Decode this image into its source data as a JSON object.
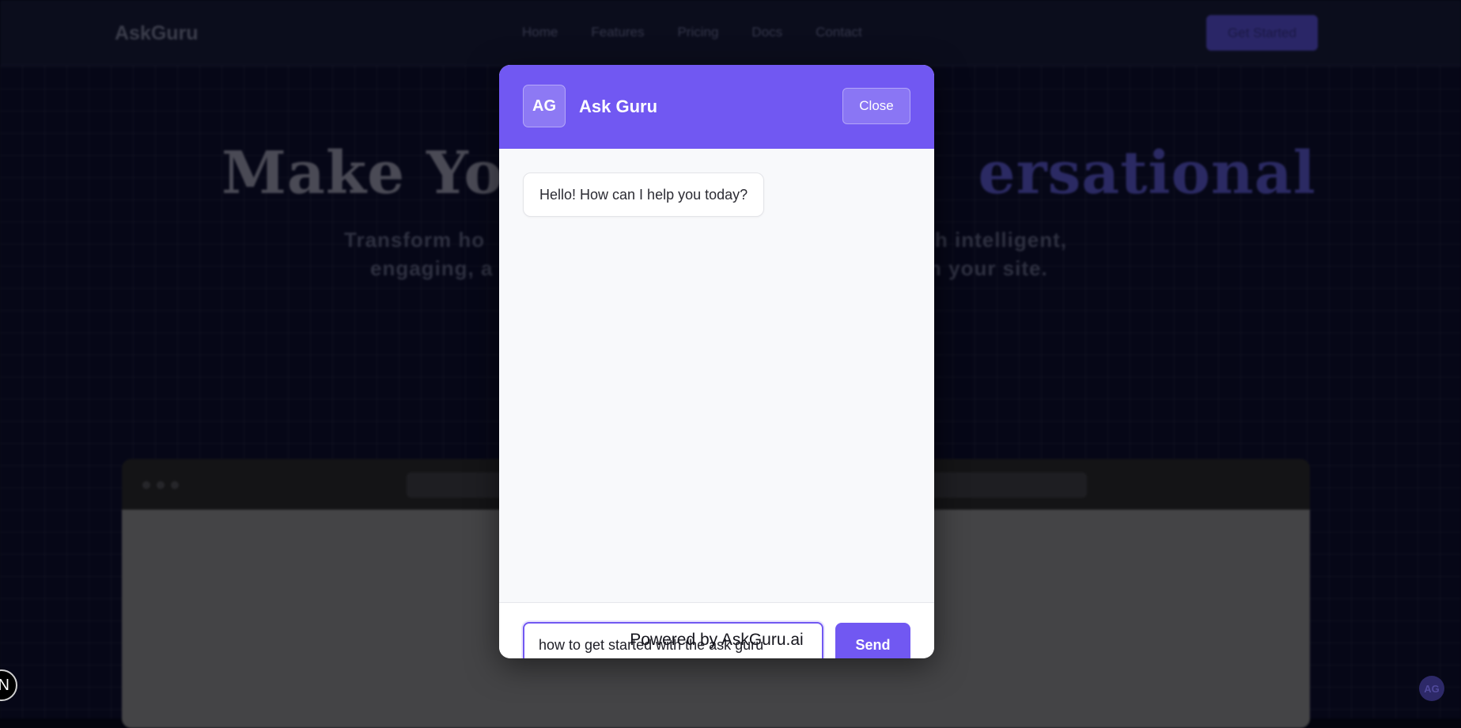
{
  "background": {
    "brand": "AskGuru",
    "nav_links": [
      "Home",
      "Features",
      "Pricing",
      "Docs",
      "Contact"
    ],
    "cta": "Get Started",
    "hero_title_left": "Make You",
    "hero_title_right": "ersational",
    "hero_sub_line1_left": "Transform ho",
    "hero_sub_line1_right": "gh intelligent,",
    "hero_sub_line2_left": "engaging, a",
    "hero_sub_line2_right": "n your site.",
    "corner_left_icon": "N",
    "corner_right_badge": "AG"
  },
  "modal": {
    "avatar": "AG",
    "title": "Ask Guru",
    "close_label": "Close",
    "messages": [
      {
        "from": "bot",
        "text": "Hello! How can I help you today?"
      }
    ],
    "input_value": "how to get started with the ask guru",
    "send_label": "Send",
    "footer": "Powered by AskGuru.ai"
  },
  "colors": {
    "accent": "#7158f2",
    "backdrop": "#060717"
  }
}
